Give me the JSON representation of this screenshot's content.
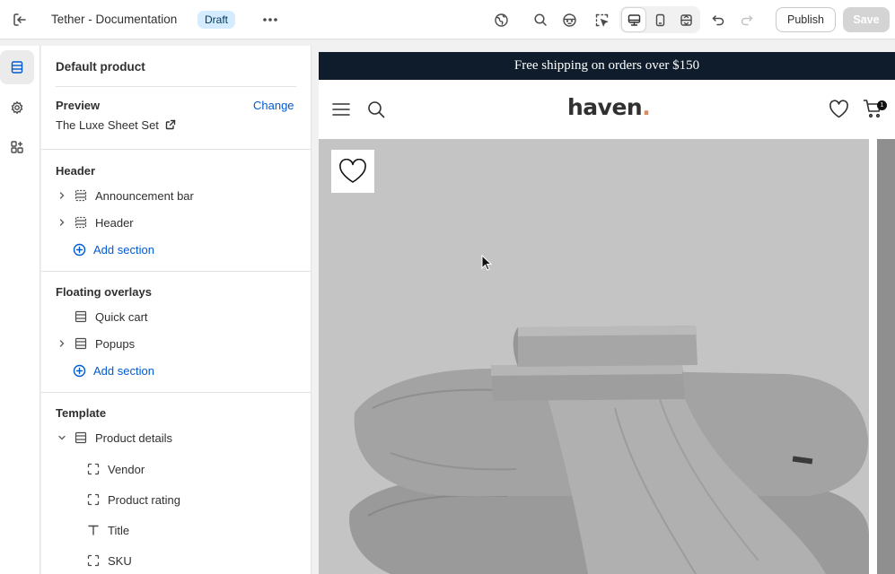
{
  "topbar": {
    "title": "Tether - Documentation",
    "status": "Draft",
    "publish_label": "Publish",
    "save_label": "Save"
  },
  "sidebar": {
    "title": "Default product",
    "preview": {
      "label": "Preview",
      "change_label": "Change",
      "product_name": "The Luxe Sheet Set"
    },
    "groups": [
      {
        "title": "Header",
        "items": [
          "Announcement bar",
          "Header"
        ],
        "add_label": "Add section"
      },
      {
        "title": "Floating overlays",
        "items": [
          "Quick cart",
          "Popups"
        ],
        "add_label": "Add section"
      },
      {
        "title": "Template",
        "section": "Product details",
        "blocks": [
          "Vendor",
          "Product rating",
          "Title",
          "SKU"
        ]
      }
    ]
  },
  "store": {
    "announcement": "Free shipping on orders over $150",
    "logo_text": "haven",
    "logo_dot": ".",
    "cart_count": "1"
  },
  "colors": {
    "accent": "#005bd3",
    "announcement_bg": "#0e1c2b",
    "logo_dot": "#d98a5f",
    "draft_badge_bg": "#d5ebff"
  }
}
